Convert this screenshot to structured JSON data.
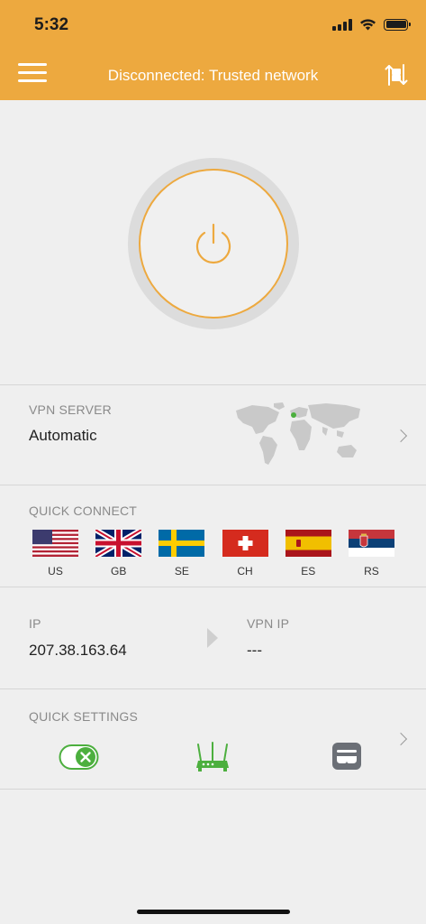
{
  "status_bar": {
    "time": "5:32"
  },
  "header": {
    "title": "Disconnected: Trusted network"
  },
  "icons": {
    "menu": "menu-icon",
    "server_list": "server-list-icon",
    "power": "power-icon",
    "world_map": "world-map-icon",
    "auto_connect": "auto-connect-toggle-icon",
    "router": "router-icon",
    "stealth": "stealth-icon"
  },
  "vpn_server": {
    "label": "VPN SERVER",
    "value": "Automatic"
  },
  "quick_connect": {
    "label": "QUICK CONNECT",
    "countries": [
      {
        "code": "US"
      },
      {
        "code": "GB"
      },
      {
        "code": "SE"
      },
      {
        "code": "CH"
      },
      {
        "code": "ES"
      },
      {
        "code": "RS"
      }
    ]
  },
  "ip_info": {
    "ip_label": "IP",
    "ip_value": "207.38.163.64",
    "vpn_ip_label": "VPN IP",
    "vpn_ip_value": "---"
  },
  "quick_settings": {
    "label": "QUICK SETTINGS"
  },
  "colors": {
    "accent": "#eda93f",
    "green": "#4caf3e",
    "background": "#efefef"
  }
}
